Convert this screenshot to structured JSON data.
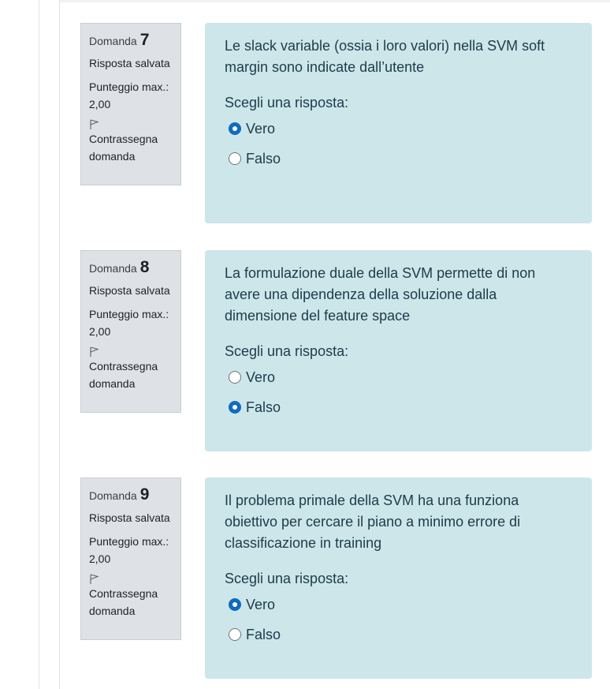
{
  "questions": [
    {
      "label": "Domanda",
      "number": "7",
      "state": "Risposta salvata",
      "grade_label": "Punteggio max.:",
      "grade_value": "2,00",
      "flag_label": "Contrassegna domanda",
      "text": "Le slack variable (ossia i loro valori) nella SVM soft margin sono indicate dall’utente",
      "prompt": "Scegli una risposta:",
      "options": [
        {
          "label": "Vero",
          "checked": true
        },
        {
          "label": "Falso",
          "checked": false
        }
      ]
    },
    {
      "label": "Domanda",
      "number": "8",
      "state": "Risposta salvata",
      "grade_label": "Punteggio max.:",
      "grade_value": "2,00",
      "flag_label": "Contrassegna domanda",
      "text": "La formulazione duale della SVM permette di non avere una dipendenza della soluzione dalla dimensione del feature space",
      "prompt": "Scegli una risposta:",
      "options": [
        {
          "label": "Vero",
          "checked": false
        },
        {
          "label": "Falso",
          "checked": true
        }
      ]
    },
    {
      "label": "Domanda",
      "number": "9",
      "state": "Risposta salvata",
      "grade_label": "Punteggio max.:",
      "grade_value": "2,00",
      "flag_label": "Contrassegna domanda",
      "text": "Il problema primale della SVM ha una funziona obiettivo per cercare il piano a minimo errore di classificazione in training",
      "prompt": "Scegli una risposta:",
      "options": [
        {
          "label": "Vero",
          "checked": true
        },
        {
          "label": "Falso",
          "checked": false
        }
      ]
    }
  ],
  "colors": {
    "info_bg": "#dee2e6",
    "content_bg": "#cce6ea",
    "radio_checked": "#0f6cbf"
  },
  "icons": {
    "flag": "flag-icon"
  }
}
